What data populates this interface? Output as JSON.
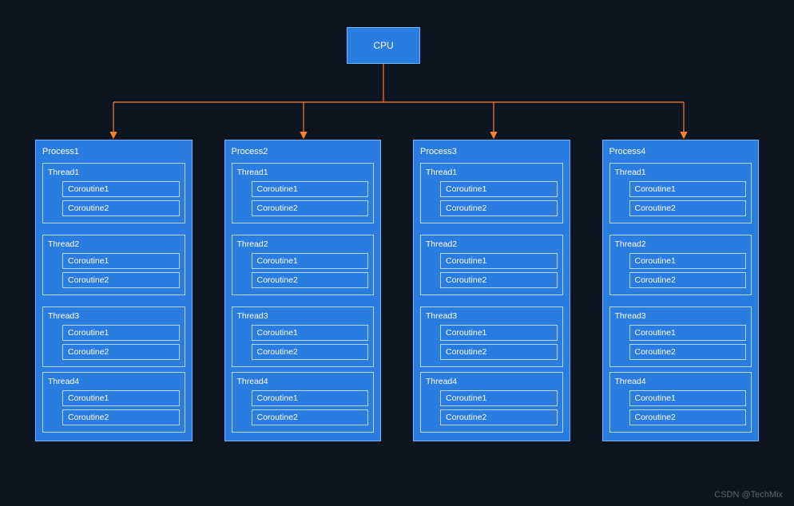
{
  "cpu": {
    "label": "CPU"
  },
  "processes": [
    {
      "label": "Process1",
      "threads": [
        {
          "label": "Thread1",
          "coroutines": [
            "Coroutine1",
            "Coroutine2"
          ]
        },
        {
          "label": "Thread2",
          "coroutines": [
            "Coroutine1",
            "Coroutine2"
          ]
        },
        {
          "label": "Thread3",
          "coroutines": [
            "Coroutine1",
            "Coroutine2"
          ]
        },
        {
          "label": "Thread4",
          "coroutines": [
            "Coroutine1",
            "Coroutine2"
          ]
        }
      ]
    },
    {
      "label": "Process2",
      "threads": [
        {
          "label": "Thread1",
          "coroutines": [
            "Coroutine1",
            "Coroutine2"
          ]
        },
        {
          "label": "Thread2",
          "coroutines": [
            "Coroutine1",
            "Coroutine2"
          ]
        },
        {
          "label": "Thread3",
          "coroutines": [
            "Coroutine1",
            "Coroutine2"
          ]
        },
        {
          "label": "Thread4",
          "coroutines": [
            "Coroutine1",
            "Coroutine2"
          ]
        }
      ]
    },
    {
      "label": "Process3",
      "threads": [
        {
          "label": "Thread1",
          "coroutines": [
            "Coroutine1",
            "Coroutine2"
          ]
        },
        {
          "label": "Thread2",
          "coroutines": [
            "Coroutine1",
            "Coroutine2"
          ]
        },
        {
          "label": "Thread3",
          "coroutines": [
            "Coroutine1",
            "Coroutine2"
          ]
        },
        {
          "label": "Thread4",
          "coroutines": [
            "Coroutine1",
            "Coroutine2"
          ]
        }
      ]
    },
    {
      "label": "Process4",
      "threads": [
        {
          "label": "Thread1",
          "coroutines": [
            "Coroutine1",
            "Coroutine2"
          ]
        },
        {
          "label": "Thread2",
          "coroutines": [
            "Coroutine1",
            "Coroutine2"
          ]
        },
        {
          "label": "Thread3",
          "coroutines": [
            "Coroutine1",
            "Coroutine2"
          ]
        },
        {
          "label": "Thread4",
          "coroutines": [
            "Coroutine1",
            "Coroutine2"
          ]
        }
      ]
    }
  ],
  "watermark": "CSDN @TechMix",
  "colors": {
    "background": "#0d1520",
    "box_fill": "#2b7ce0",
    "box_border": "#6fb7ff",
    "inner_border": "#b8d9ff",
    "connector": "#ff7f2a"
  }
}
